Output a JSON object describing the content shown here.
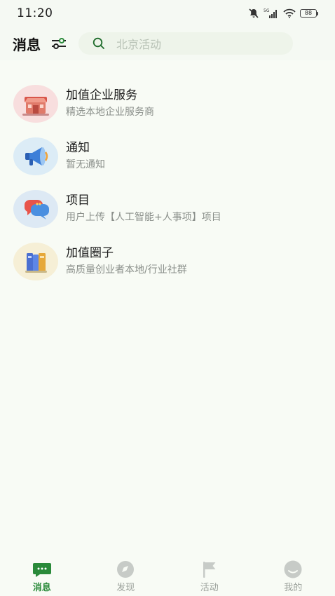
{
  "status": {
    "time": "11:20",
    "network": "5G",
    "battery": "88"
  },
  "header": {
    "title": "消息",
    "search_placeholder": "北京活动"
  },
  "list": [
    {
      "title": "加值企业服务",
      "subtitle": "精选本地企业服务商",
      "icon": "storefront-icon",
      "bg": "#f8dede"
    },
    {
      "title": "通知",
      "subtitle": "暂无通知",
      "icon": "megaphone-icon",
      "bg": "#dcecf6"
    },
    {
      "title": "项目",
      "subtitle": "用户上传【人工智能+人事项】项目",
      "icon": "chat-bubbles-icon",
      "bg": "#dde9f4"
    },
    {
      "title": "加值圈子",
      "subtitle": "高质量创业者本地/行业社群",
      "icon": "books-icon",
      "bg": "#f6efd6"
    }
  ],
  "tabs": [
    {
      "label": "消息",
      "icon": "message-icon",
      "active": true
    },
    {
      "label": "发现",
      "icon": "compass-icon",
      "active": false
    },
    {
      "label": "活动",
      "icon": "flag-icon",
      "active": false
    },
    {
      "label": "我的",
      "icon": "profile-icon",
      "active": false
    }
  ],
  "colors": {
    "accent": "#2a8a3a",
    "background": "#f8fbf5",
    "search_bg": "#eef4ea",
    "inactive": "#9aa09a"
  }
}
